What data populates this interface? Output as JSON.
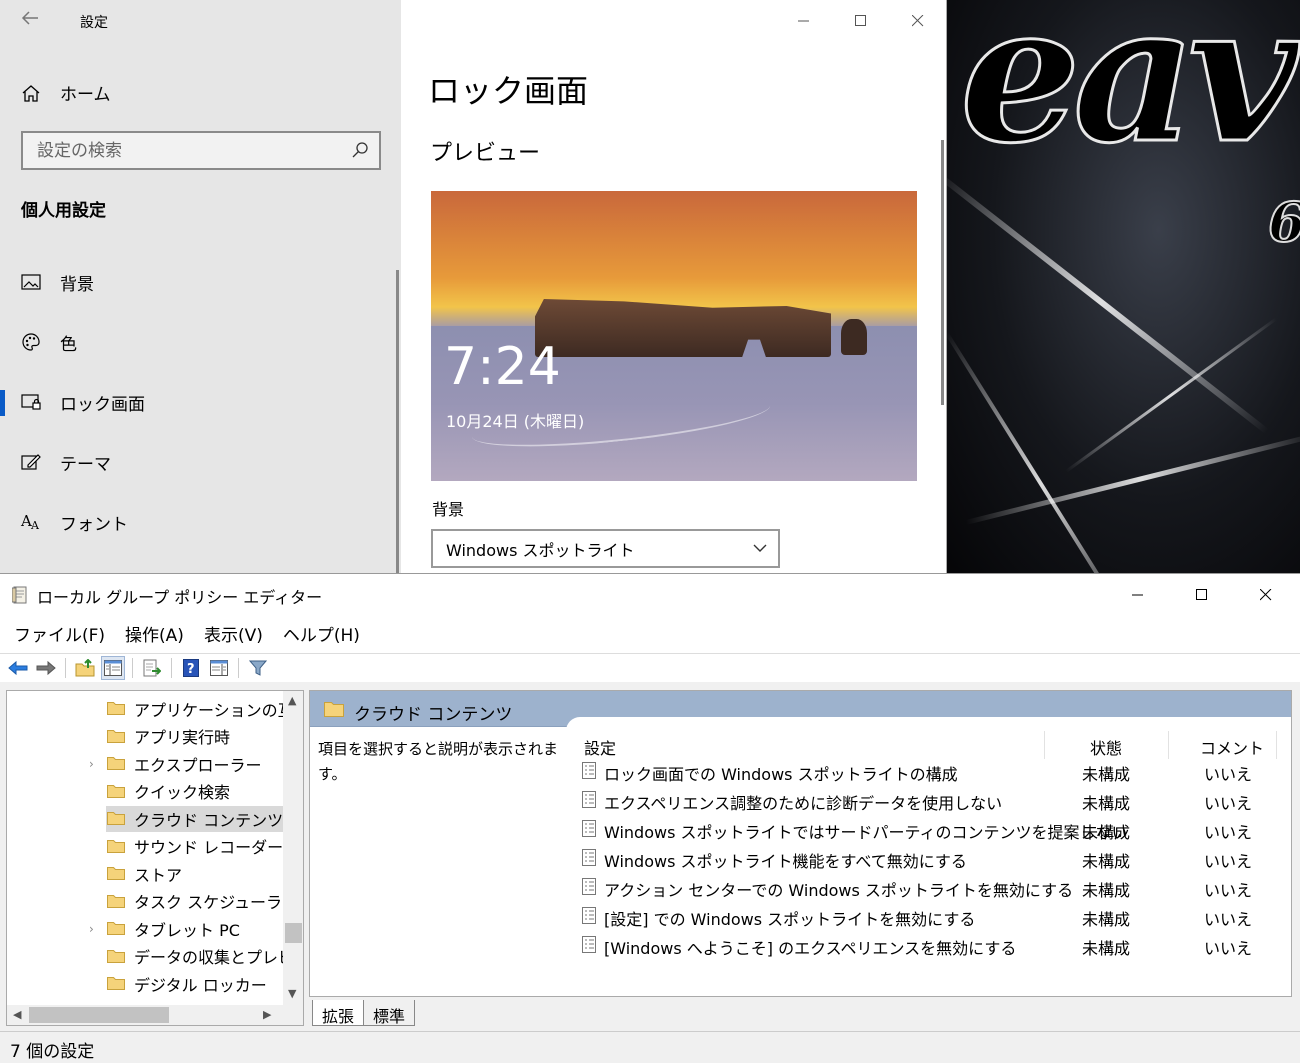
{
  "settings": {
    "app_title": "設定",
    "home_label": "ホーム",
    "search_placeholder": "設定の検索",
    "section_title": "個人用設定",
    "nav_items": [
      {
        "label": "背景",
        "icon": "picture-icon"
      },
      {
        "label": "色",
        "icon": "palette-icon"
      },
      {
        "label": "ロック画面",
        "icon": "lock-screen-icon",
        "active": true
      },
      {
        "label": "テーマ",
        "icon": "theme-icon"
      },
      {
        "label": "フォント",
        "icon": "font-icon"
      }
    ],
    "page_title": "ロック画面",
    "preview_title": "プレビュー",
    "preview_time": "7:24",
    "preview_date": "10月24日 (木曜日)",
    "background_label": "背景",
    "background_value": "Windows スポットライト"
  },
  "gpe": {
    "window_title": "ローカル グループ ポリシー エディター",
    "menu": [
      "ファイル(F)",
      "操作(A)",
      "表示(V)",
      "ヘルプ(H)"
    ],
    "tree_items": [
      {
        "label": "アプリケーションの互換",
        "expandable": false
      },
      {
        "label": "アプリ実行時",
        "expandable": false
      },
      {
        "label": "エクスプローラー",
        "expandable": true
      },
      {
        "label": "クイック検索",
        "expandable": false
      },
      {
        "label": "クラウド コンテンツ",
        "expandable": false,
        "selected": true
      },
      {
        "label": "サウンド レコーダー",
        "expandable": false
      },
      {
        "label": "ストア",
        "expandable": false
      },
      {
        "label": "タスク スケジューラ",
        "expandable": false
      },
      {
        "label": "タブレット PC",
        "expandable": true
      },
      {
        "label": "データの収集とプレビュ",
        "expandable": false
      },
      {
        "label": "デジタル ロッカー",
        "expandable": false
      }
    ],
    "content_title": "クラウド コンテンツ",
    "description": "項目を選択すると説明が表示されます。",
    "columns": {
      "setting": "設定",
      "state": "状態",
      "comment": "コメント"
    },
    "rows": [
      {
        "name": "ロック画面での Windows スポットライトの構成",
        "state": "未構成",
        "comment": "いいえ"
      },
      {
        "name": "エクスペリエンス調整のために診断データを使用しない",
        "state": "未構成",
        "comment": "いいえ"
      },
      {
        "name": "Windows スポットライトではサードパーティのコンテンツを提案しない",
        "state": "未構成",
        "comment": "いいえ"
      },
      {
        "name": "Windows スポットライト機能をすべて無効にする",
        "state": "未構成",
        "comment": "いいえ"
      },
      {
        "name": "アクション センターでの Windows スポットライトを無効にする",
        "state": "未構成",
        "comment": "いいえ"
      },
      {
        "name": "[設定] での Windows スポットライトを無効にする",
        "state": "未構成",
        "comment": "いいえ"
      },
      {
        "name": "[Windows へようこそ] のエクスペリエンスを無効にする",
        "state": "未構成",
        "comment": "いいえ"
      }
    ],
    "tabs": [
      "拡張",
      "標準"
    ],
    "status_text": "7 個の設定"
  },
  "colors": {
    "accent": "#0a5bc7",
    "header_blue": "#9db2cd",
    "folder": "#f5d37a"
  }
}
